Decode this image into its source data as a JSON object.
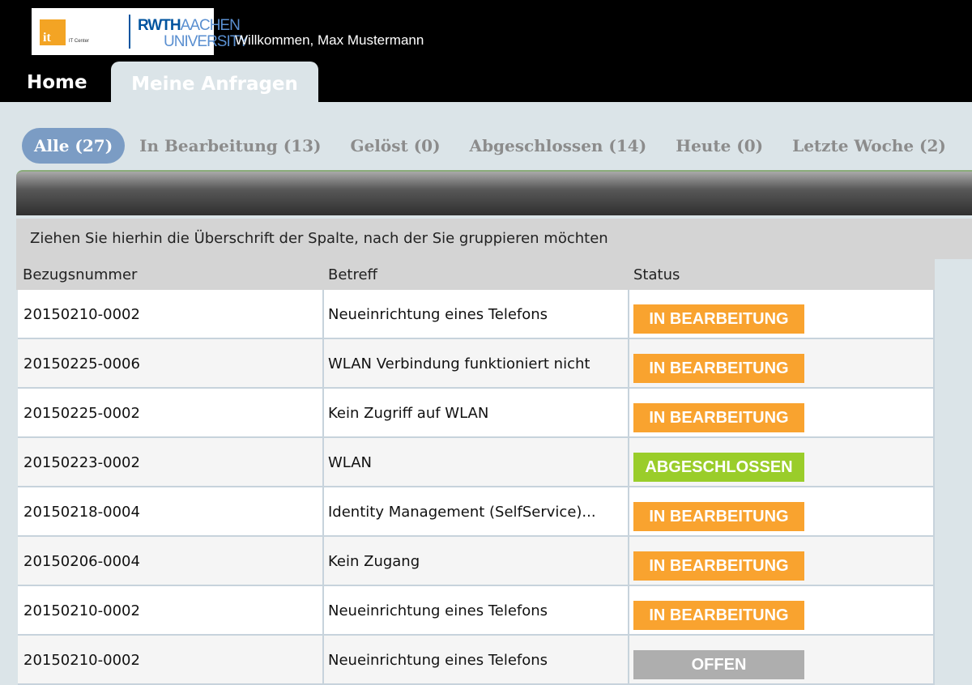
{
  "header": {
    "logo": {
      "itc_letters": "it",
      "itc_caption": "IT Center",
      "rwth_bold": "RWTH",
      "rwth_light": "AACHEN",
      "university": "UNIVERSITY"
    },
    "welcome": "Willkommen, Max Mustermann",
    "nav": {
      "home": "Home",
      "active_tab": "Meine Anfragen"
    }
  },
  "filters": [
    {
      "label": "Alle (27)",
      "active": true
    },
    {
      "label": "In Bearbeitung (13)",
      "active": false
    },
    {
      "label": "Gelöst (0)",
      "active": false
    },
    {
      "label": "Abgeschlossen (14)",
      "active": false
    },
    {
      "label": "Heute (0)",
      "active": false
    },
    {
      "label": "Letzte Woche (2)",
      "active": false
    }
  ],
  "grid": {
    "group_hint": "Ziehen Sie hierhin die Überschrift der Spalte, nach der Sie gruppieren möchten",
    "columns": {
      "ref": "Bezugsnummer",
      "subject": "Betreff",
      "status": "Status"
    },
    "status_colors": {
      "IN BEARBEITUNG": "#f9a32f",
      "ABGESCHLOSSEN": "#9acd2a",
      "OFFEN": "#aeaeae"
    },
    "rows": [
      {
        "ref": "20150210-0002",
        "subject": "Neueinrichtung eines Telefons",
        "status": "IN BEARBEITUNG"
      },
      {
        "ref": "20150225-0006",
        "subject": "WLAN Verbindung funktioniert nicht",
        "status": "IN BEARBEITUNG"
      },
      {
        "ref": "20150225-0002",
        "subject": "Kein Zugriff auf WLAN",
        "status": "IN BEARBEITUNG"
      },
      {
        "ref": "20150223-0002",
        "subject": "WLAN",
        "status": "ABGESCHLOSSEN"
      },
      {
        "ref": "20150218-0004",
        "subject": "Identity Management (SelfService)...",
        "status": "IN BEARBEITUNG"
      },
      {
        "ref": "20150206-0004",
        "subject": "Kein Zugang",
        "status": "IN BEARBEITUNG"
      },
      {
        "ref": "20150210-0002",
        "subject": "Neueinrichtung eines Telefons",
        "status": "IN BEARBEITUNG"
      },
      {
        "ref": "20150210-0002",
        "subject": "Neueinrichtung eines Telefons",
        "status": "OFFEN"
      }
    ]
  }
}
